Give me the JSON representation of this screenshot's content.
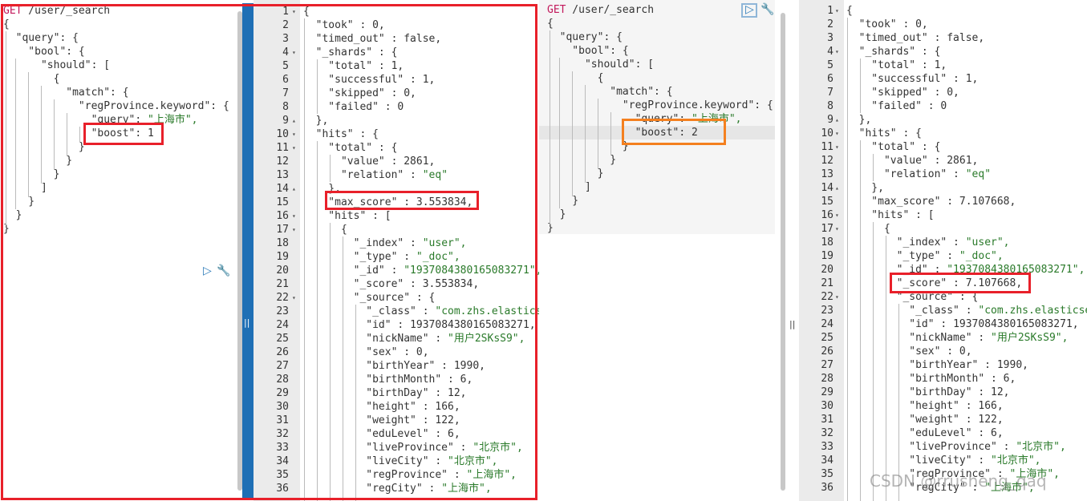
{
  "left_request": {
    "lines": [
      "GET /user/_search",
      "{",
      "  \"query\": {",
      "    \"bool\": {",
      "      \"should\": [",
      "        {",
      "          \"match\": {",
      "            \"regProvince.keyword\": {",
      "              \"query\": \"上海市\",",
      "              \"boost\": 1",
      "            }",
      "          }",
      "        }",
      "      ]",
      "    }",
      "  }",
      "}"
    ]
  },
  "left_response": {
    "line_numbers": [
      "1",
      "2",
      "3",
      "4",
      "5",
      "6",
      "7",
      "8",
      "9",
      "10",
      "11",
      "12",
      "13",
      "14",
      "15",
      "16",
      "17",
      "18",
      "19",
      "20",
      "21",
      "22",
      "23",
      "24",
      "25",
      "26",
      "27",
      "28",
      "29",
      "30",
      "31",
      "32",
      "33",
      "34",
      "35",
      "36"
    ],
    "lines": [
      "{",
      "  \"took\" : 0,",
      "  \"timed_out\" : false,",
      "  \"_shards\" : {",
      "    \"total\" : 1,",
      "    \"successful\" : 1,",
      "    \"skipped\" : 0,",
      "    \"failed\" : 0",
      "  },",
      "  \"hits\" : {",
      "    \"total\" : {",
      "      \"value\" : 2861,",
      "      \"relation\" : \"eq\"",
      "    },",
      "    \"max_score\" : 3.553834,",
      "    \"hits\" : [",
      "      {",
      "        \"_index\" : \"user\",",
      "        \"_type\" : \"_doc\",",
      "        \"_id\" : \"1937084380165083271\",",
      "        \"_score\" : 3.553834,",
      "        \"_source\" : {",
      "          \"_class\" : \"com.zhs.elasticsea",
      "          \"id\" : 1937084380165083271,",
      "          \"nickName\" : \"用户2SKsS9\",",
      "          \"sex\" : 0,",
      "          \"birthYear\" : 1990,",
      "          \"birthMonth\" : 6,",
      "          \"birthDay\" : 12,",
      "          \"height\" : 166,",
      "          \"weight\" : 122,",
      "          \"eduLevel\" : 6,",
      "          \"liveProvince\" : \"北京市\",",
      "          \"liveCity\" : \"北京市\",",
      "          \"regProvince\" : \"上海市\",",
      "          \"regCity\" : \"上海市\","
    ]
  },
  "right_request": {
    "lines": [
      "GET /user/_search",
      "{",
      "  \"query\": {",
      "    \"bool\": {",
      "      \"should\": [",
      "        {",
      "          \"match\": {",
      "            \"regProvince.keyword\": {",
      "              \"query\": \"上海市\",",
      "              \"boost\": 2",
      "            }",
      "          }",
      "        }",
      "      ]",
      "    }",
      "  }",
      "}"
    ]
  },
  "right_response": {
    "line_numbers": [
      "1",
      "2",
      "3",
      "4",
      "5",
      "6",
      "7",
      "8",
      "9",
      "10",
      "11",
      "12",
      "13",
      "14",
      "15",
      "16",
      "17",
      "18",
      "19",
      "20",
      "21",
      "22",
      "23",
      "24",
      "25",
      "26",
      "27",
      "28",
      "29",
      "30",
      "31",
      "32",
      "33",
      "34",
      "35",
      "36"
    ],
    "lines": [
      "{",
      "  \"took\" : 0,",
      "  \"timed_out\" : false,",
      "  \"_shards\" : {",
      "    \"total\" : 1,",
      "    \"successful\" : 1,",
      "    \"skipped\" : 0,",
      "    \"failed\" : 0",
      "  },",
      "  \"hits\" : {",
      "    \"total\" : {",
      "      \"value\" : 2861,",
      "      \"relation\" : \"eq\"",
      "    },",
      "    \"max_score\" : 7.107668,",
      "    \"hits\" : [",
      "      {",
      "        \"_index\" : \"user\",",
      "        \"_type\" : \"_doc\",",
      "        \"_id\" : \"1937084380165083271\",",
      "        \"_score\" : 7.107668,",
      "        \"_source\" : {",
      "          \"_class\" : \"com.zhs.elasticsea",
      "          \"id\" : 1937084380165083271,",
      "          \"nickName\" : \"用户2SKsS9\",",
      "          \"sex\" : 0,",
      "          \"birthYear\" : 1990,",
      "          \"birthMonth\" : 6,",
      "          \"birthDay\" : 12,",
      "          \"height\" : 166,",
      "          \"weight\" : 122,",
      "          \"eduLevel\" : 6,",
      "          \"liveProvince\" : \"北京市\",",
      "          \"liveCity\" : \"北京市\",",
      "          \"regProvince\" : \"上海市\",",
      "          \"regCity\" : \"上海市\","
    ]
  },
  "divider_glyph": "||",
  "watermark": "CSDN @rrusheng_qaq",
  "icons": {
    "run": "play-icon",
    "settings": "wrench-icon"
  },
  "colors": {
    "highlight_red": "#e8202a",
    "highlight_orange": "#f4801f",
    "splitter_blue": "#1e6fb5",
    "string_green": "#2a7a2a",
    "method_pink": "#c2185b"
  }
}
